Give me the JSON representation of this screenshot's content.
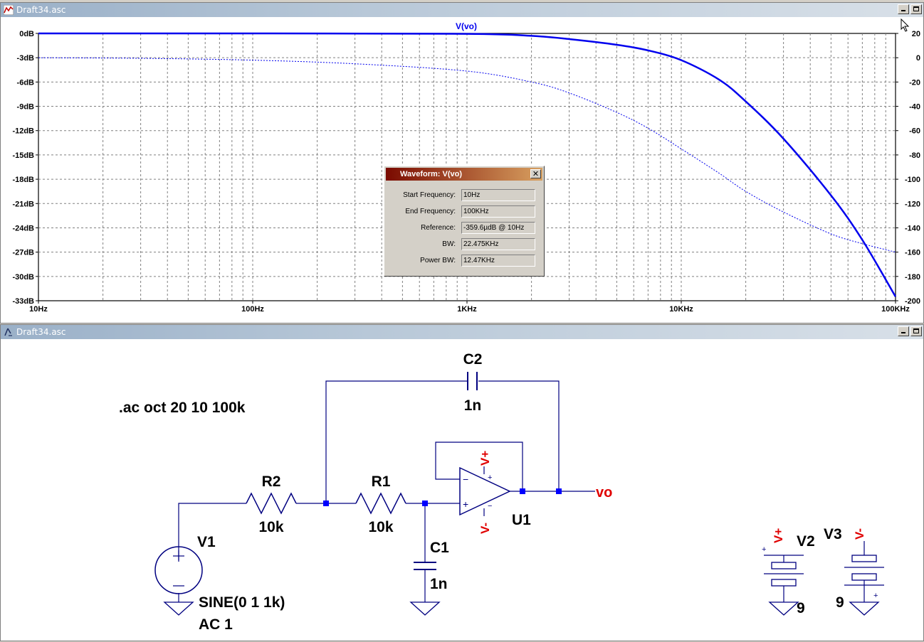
{
  "plot_window": {
    "title": "Draft34.asc",
    "trace_label": "V(vo)"
  },
  "schematic_window": {
    "title": "Draft34.asc"
  },
  "chart_data": {
    "type": "line",
    "title": "V(vo)",
    "x_scale": "log",
    "x_ticks": [
      "10Hz",
      "100Hz",
      "1KHz",
      "10KHz",
      "100KHz"
    ],
    "xlim": [
      "10Hz",
      "100KHz"
    ],
    "y_left_ticks": [
      "0dB",
      "-3dB",
      "-6dB",
      "-9dB",
      "-12dB",
      "-15dB",
      "-18dB",
      "-21dB",
      "-24dB",
      "-27dB",
      "-30dB",
      "-33dB"
    ],
    "y_left_range": [
      -33,
      0
    ],
    "y_right_ticks": [
      "20",
      "0",
      "-20",
      "-40",
      "-60",
      "-80",
      "-100",
      "-120",
      "-140",
      "-160",
      "-180",
      "-200"
    ],
    "y_right_range": [
      -200,
      20
    ],
    "grid": true,
    "series": [
      {
        "name": "V(vo) magnitude",
        "axis": "left",
        "style": "solid",
        "color": "#0000ee",
        "x": [
          10,
          100,
          1000,
          2000,
          3000,
          5000,
          7000,
          10000,
          15000,
          20000,
          30000,
          50000,
          70000,
          100000
        ],
        "y": [
          0,
          0,
          -0.05,
          -0.3,
          -0.7,
          -1.4,
          -2.1,
          -3.3,
          -5.7,
          -8.4,
          -13,
          -20,
          -25.5,
          -32.5
        ]
      },
      {
        "name": "V(vo) phase",
        "axis": "right",
        "style": "dotted",
        "color": "#0000ee",
        "x": [
          10,
          30,
          100,
          300,
          1000,
          2000,
          3000,
          5000,
          7000,
          10000,
          15000,
          20000,
          30000,
          50000,
          70000,
          100000
        ],
        "y": [
          0,
          -0.5,
          -2,
          -5,
          -11,
          -20,
          -29,
          -45,
          -58,
          -75,
          -95,
          -110,
          -127,
          -145,
          -153,
          -160
        ]
      }
    ]
  },
  "dialog": {
    "title": "Waveform: V(vo)",
    "rows": [
      {
        "label": "Start Frequency:",
        "value": "10Hz"
      },
      {
        "label": "End Frequency:",
        "value": "100KHz"
      },
      {
        "label": "Reference:",
        "value": "-359.6µdB @ 10Hz"
      },
      {
        "label": "BW:",
        "value": "22.475KHz"
      },
      {
        "label": "Power BW:",
        "value": "12.47KHz"
      }
    ]
  },
  "schematic": {
    "directive": ".ac oct 20 10 100k",
    "r2": {
      "ref": "R2",
      "value": "10k"
    },
    "r1": {
      "ref": "R1",
      "value": "10k"
    },
    "c1": {
      "ref": "C1",
      "value": "1n"
    },
    "c2": {
      "ref": "C2",
      "value": "1n"
    },
    "u1": {
      "ref": "U1"
    },
    "v1": {
      "ref": "V1",
      "value1": "SINE(0 1 1k)",
      "value2": "AC 1"
    },
    "v2": {
      "ref": "V2",
      "value": "9"
    },
    "v3": {
      "ref": "V3",
      "value": "9"
    },
    "vo_label": "vo",
    "pos_rail": "V+",
    "neg_rail": "V-",
    "plus_sign": "+",
    "minus_sign": "−",
    "colors": {
      "wire": "#000080",
      "net_label": "#e00000",
      "junction": "#0000ff",
      "component": "#000080"
    }
  }
}
